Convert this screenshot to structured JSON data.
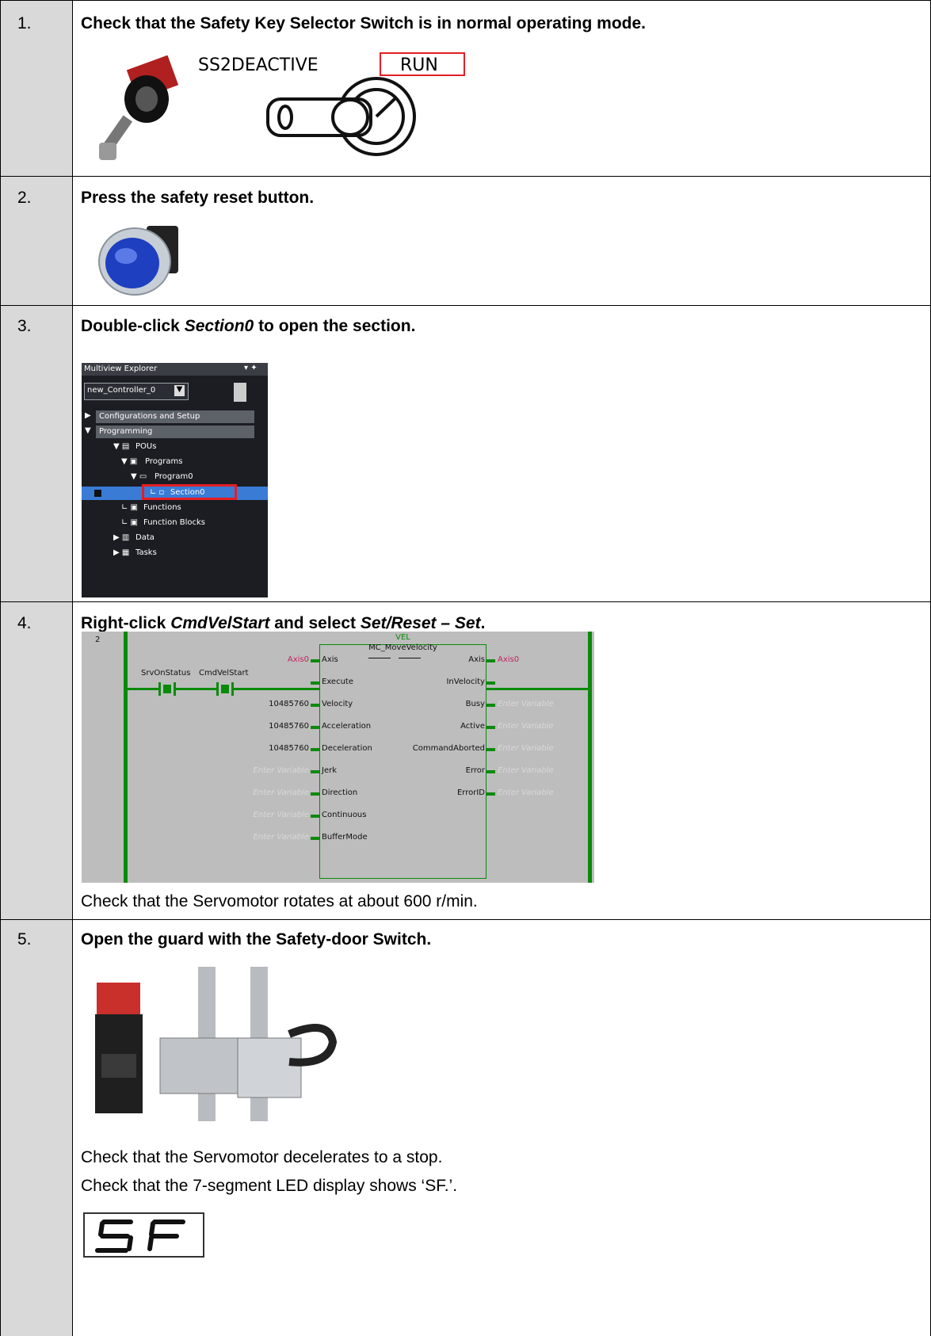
{
  "steps": [
    {
      "num": "1.",
      "title": "Check that the Safety Key Selector Switch is in normal operating mode."
    },
    {
      "num": "2.",
      "title": "Press the safety reset button."
    },
    {
      "num": "3.",
      "title_parts": [
        "Double-click ",
        "Section0",
        " to open the section."
      ]
    },
    {
      "num": "4.",
      "title_parts": [
        "Right-click ",
        "CmdVelStart",
        " and select ",
        "Set/Reset – Set",
        "."
      ],
      "note": "Check that the Servomotor rotates at about 600 r/min."
    },
    {
      "num": "5.",
      "title": "Open the guard with the Safety-door Switch.",
      "notes": [
        "Check that the Servomotor decelerates to a stop.",
        "Check that the 7-segment LED display shows ‘SF.’."
      ]
    }
  ],
  "key_switch": {
    "left_label": "SS2DEACTIVE",
    "right_label": "RUN"
  },
  "explorer": {
    "header": "Multiview Explorer",
    "controller": "new_Controller_0",
    "items": [
      "Configurations and Setup",
      "Programming",
      "POUs",
      "Programs",
      "Program0",
      "Section0",
      "Functions",
      "Function Blocks",
      "Data",
      "Tasks"
    ]
  },
  "ladder": {
    "rung": "2",
    "contacts": [
      "SrvOnStatus",
      "CmdVelStart"
    ],
    "block_type": "VEL",
    "block_name": "MC_MoveVelocity",
    "inputs": [
      {
        "pin": "Axis",
        "value": "Axis0"
      },
      {
        "pin": "Execute",
        "value": ""
      },
      {
        "pin": "Velocity",
        "value": "10485760"
      },
      {
        "pin": "Acceleration",
        "value": "10485760"
      },
      {
        "pin": "Deceleration",
        "value": "10485760"
      },
      {
        "pin": "Jerk",
        "value": "Enter Variable"
      },
      {
        "pin": "Direction",
        "value": "Enter Variable"
      },
      {
        "pin": "Continuous",
        "value": "Enter Variable"
      },
      {
        "pin": "BufferMode",
        "value": "Enter Variable"
      }
    ],
    "outputs": [
      {
        "pin": "Axis",
        "value": "Axis0"
      },
      {
        "pin": "InVelocity",
        "value": ""
      },
      {
        "pin": "Busy",
        "value": "Enter Variable"
      },
      {
        "pin": "Active",
        "value": "Enter Variable"
      },
      {
        "pin": "CommandAborted",
        "value": "Enter Variable"
      },
      {
        "pin": "Error",
        "value": "Enter Variable"
      },
      {
        "pin": "ErrorID",
        "value": "Enter Variable"
      }
    ]
  },
  "led_display": "SF"
}
